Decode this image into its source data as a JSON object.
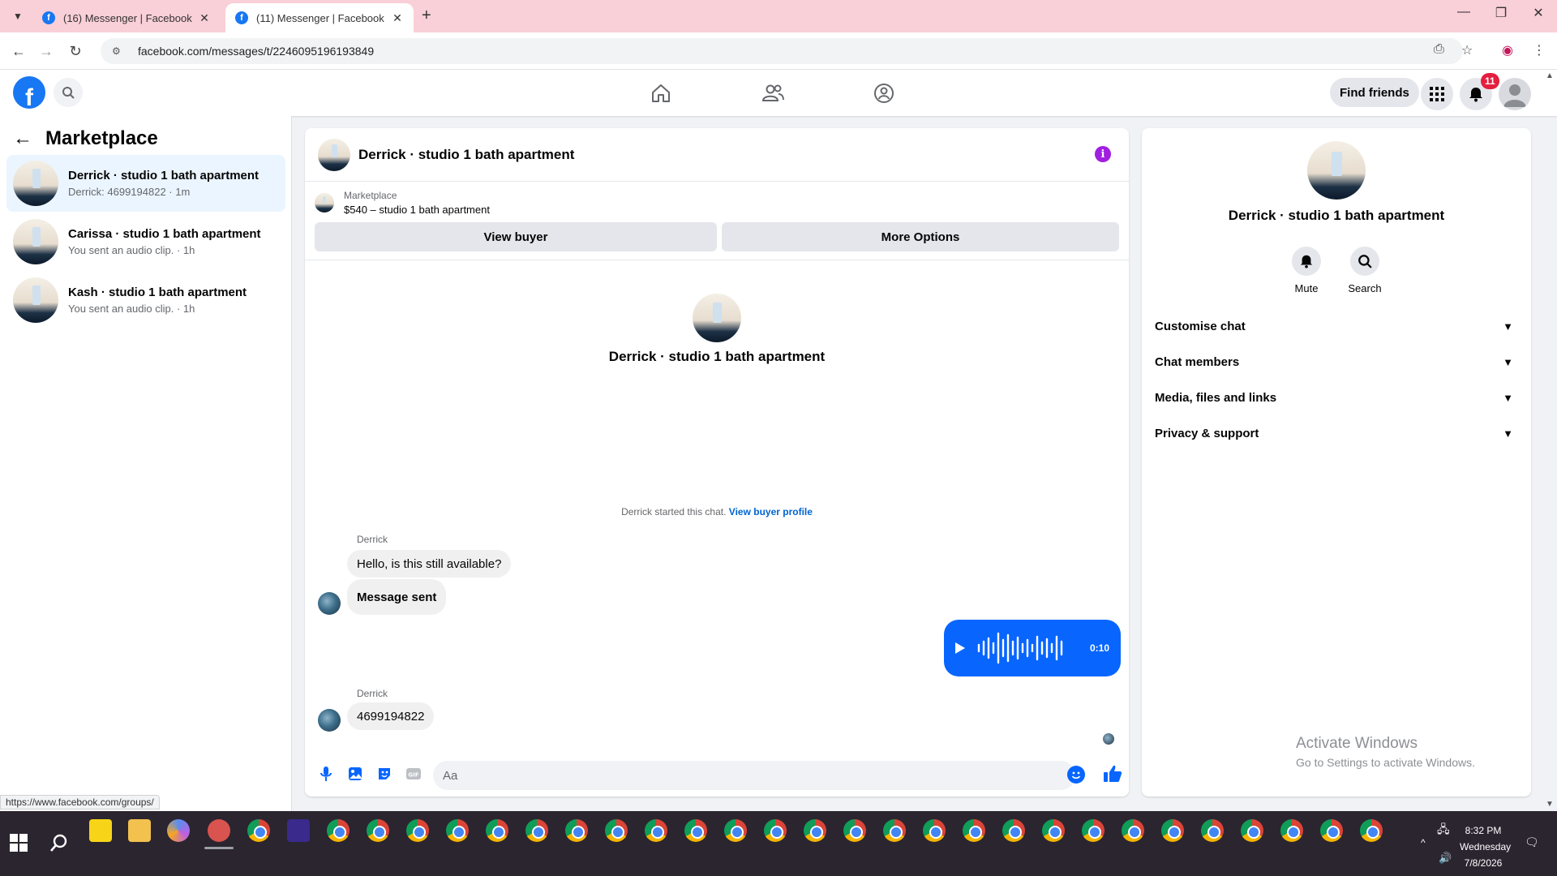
{
  "browser": {
    "tabs": [
      {
        "title": "(16) Messenger | Facebook",
        "active": false
      },
      {
        "title": "(11) Messenger | Facebook",
        "active": true
      }
    ],
    "url": "facebook.com/messages/t/2246095196193849",
    "status_url": "https://www.facebook.com/groups/"
  },
  "header": {
    "find_friends": "Find friends",
    "notification_count": "11"
  },
  "sidebar": {
    "title": "Marketplace",
    "conversations": [
      {
        "name": "Derrick · studio 1 bath apartment",
        "snippet": "Derrick: 4699194822 · 1m",
        "active": true
      },
      {
        "name": "Carissa · studio 1 bath apartment",
        "snippet": "You sent an audio clip. · 1h",
        "active": false
      },
      {
        "name": "Kash · studio 1 bath apartment",
        "snippet": "You sent an audio clip. · 1h",
        "active": false
      }
    ]
  },
  "chat": {
    "title": "Derrick · studio 1 bath apartment",
    "listing_label": "Marketplace",
    "listing_price": "$540 – studio 1 bath apartment",
    "view_buyer": "View buyer",
    "more_options": "More Options",
    "intro_name": "Derrick · studio 1 bath apartment",
    "started_text": "Derrick started this chat.",
    "view_buyer_profile": "View buyer profile",
    "messages": [
      {
        "sender": "Derrick",
        "text": "Hello, is this still available?"
      },
      {
        "text": "Message sent"
      },
      {
        "sender": "Derrick",
        "text": "4699194822"
      }
    ],
    "audio_duration": "0:10",
    "composer_placeholder": "Aa"
  },
  "info_panel": {
    "name": "Derrick · studio 1 bath apartment",
    "mute": "Mute",
    "search": "Search",
    "sections": [
      "Customise chat",
      "Chat members",
      "Media, files and links",
      "Privacy & support"
    ]
  },
  "watermark": {
    "line1": "Activate Windows",
    "line2": "Go to Settings to activate Windows."
  },
  "taskbar": {
    "time": "8:32 PM",
    "day": "Wednesday",
    "date": "7/8/2026"
  },
  "colors": {
    "fb_blue": "#1877f2",
    "messenger_blue": "#0866ff",
    "tabbar_pink": "#f9cfd8",
    "active_convo": "#ebf5ff",
    "info_purple": "#a01fe0"
  }
}
